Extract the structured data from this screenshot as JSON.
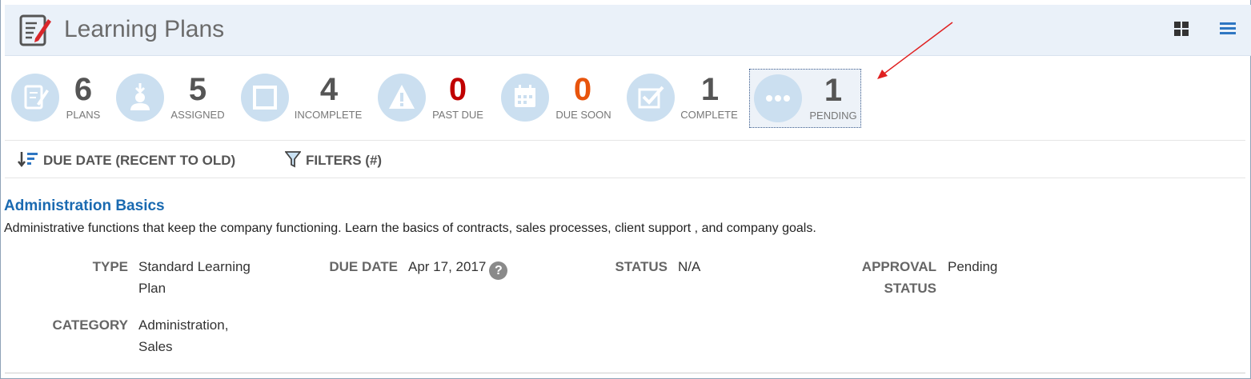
{
  "header": {
    "title": "Learning Plans",
    "icons": {
      "app": "edit-document-icon",
      "grid_view": "grid-view-icon",
      "list_view": "list-view-icon"
    }
  },
  "stats": [
    {
      "value": "6",
      "label": "PLANS",
      "icon": "document-icon",
      "color": "#555555"
    },
    {
      "value": "5",
      "label": "ASSIGNED",
      "icon": "user-download-icon",
      "color": "#555555"
    },
    {
      "value": "4",
      "label": "INCOMPLETE",
      "icon": "square-icon",
      "color": "#555555"
    },
    {
      "value": "0",
      "label": "PAST DUE",
      "icon": "warning-icon",
      "color": "#c00000"
    },
    {
      "value": "0",
      "label": "DUE SOON",
      "icon": "calendar-icon",
      "color": "#e8540c"
    },
    {
      "value": "1",
      "label": "COMPLETE",
      "icon": "checkbox-icon",
      "color": "#555555"
    },
    {
      "value": "1",
      "label": "PENDING",
      "icon": "ellipsis-icon",
      "color": "#555555",
      "selected": true
    }
  ],
  "toolbar": {
    "sort_label": "DUE DATE (RECENT TO OLD)",
    "filters_label": "FILTERS (#)"
  },
  "plan": {
    "title": "Administration Basics",
    "description": "Administrative functions that keep the company functioning. Learn the basics of contracts, sales processes, client support , and company goals.",
    "type_label": "TYPE",
    "type_value_line1": "Standard Learning",
    "type_value_line2": "Plan",
    "due_date_label": "DUE DATE",
    "due_date_value": "Apr 17, 2017",
    "help_glyph": "?",
    "status_label": "STATUS",
    "status_value": "N/A",
    "approval_label_line1": "APPROVAL",
    "approval_label_line2": "STATUS",
    "approval_value": "Pending",
    "category_label": "CATEGORY",
    "category_value_line1": "Administration,",
    "category_value_line2": "Sales"
  },
  "colors": {
    "accent": "#1a6ab1",
    "header_bg": "#eaf1f9",
    "circle_bg": "#cbdff0",
    "past_due": "#c00000",
    "due_soon": "#e8540c",
    "annotation_arrow": "#e02020"
  }
}
